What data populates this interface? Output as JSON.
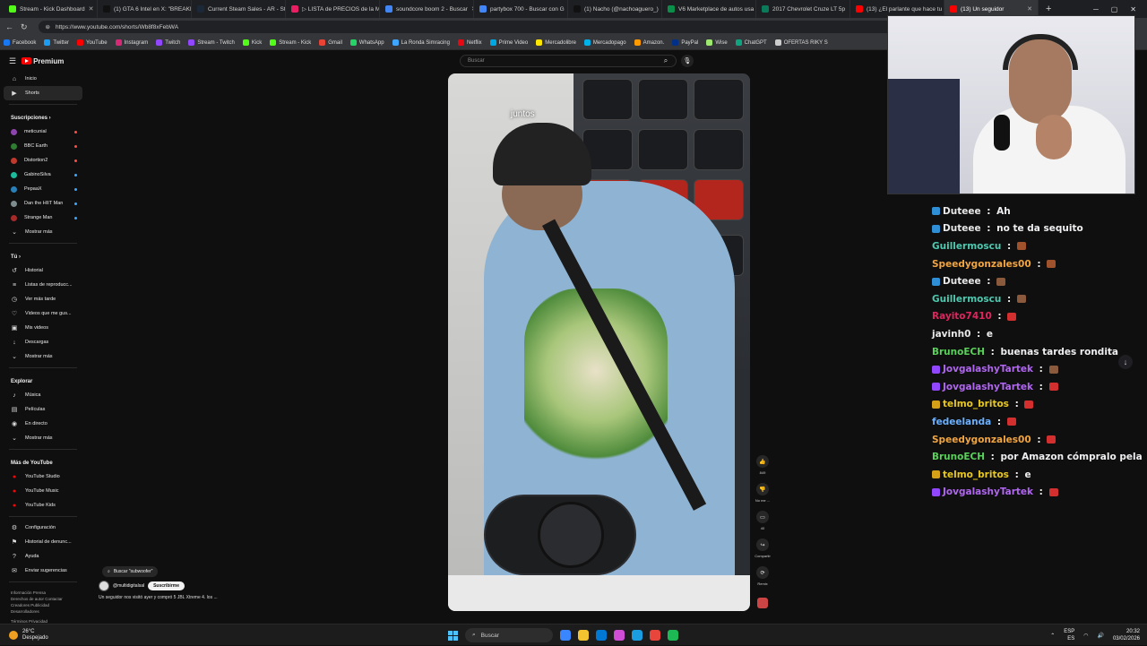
{
  "browser": {
    "tabs": [
      {
        "title": "Stream - Kick Dashboard",
        "color": "#53fc18"
      },
      {
        "title": "(1) GTA 6 Intel en X: \"BREAKI",
        "color": "#111111"
      },
      {
        "title": "Current Steam Sales - AR - St",
        "color": "#1b2838"
      },
      {
        "title": "▷ LISTA de PRECIOS de la M",
        "color": "#e91e63"
      },
      {
        "title": "soundcore boom 2 - Buscar",
        "color": "#4285f4"
      },
      {
        "title": "partybox 700 - Buscar con G",
        "color": "#4285f4"
      },
      {
        "title": "(1) Nacho (@nachoaguero_)",
        "color": "#111111"
      },
      {
        "title": "V6 Marketplace de autos usa",
        "color": "#0a8f4a"
      },
      {
        "title": "2017 Chevrolet Cruze LT 5p",
        "color": "#0b7a5a"
      },
      {
        "title": "(13) ¿El parlante que hace tu",
        "color": "#ff0000"
      },
      {
        "title": "(13) Un seguidor",
        "color": "#ff0000"
      }
    ],
    "new_tab": "+",
    "url": "https://www.youtube.com/shorts/Wb8f8xFebWA",
    "bookmarks": [
      {
        "label": "Facebook",
        "color": "#1877f2"
      },
      {
        "label": "Twitter",
        "color": "#1d9bf0"
      },
      {
        "label": "YouTube",
        "color": "#ff0000"
      },
      {
        "label": "Instagram",
        "color": "#d62976"
      },
      {
        "label": "Twitch",
        "color": "#9146ff"
      },
      {
        "label": "Stream - Twitch",
        "color": "#9146ff"
      },
      {
        "label": "Kick",
        "color": "#53fc18"
      },
      {
        "label": "Stream - Kick",
        "color": "#53fc18"
      },
      {
        "label": "Gmail",
        "color": "#ea4335"
      },
      {
        "label": "WhatsApp",
        "color": "#25d366"
      },
      {
        "label": "La Ronda Simracing",
        "color": "#3ea6ff"
      },
      {
        "label": "Netflix",
        "color": "#e50914"
      },
      {
        "label": "Prime Video",
        "color": "#00a8e1"
      },
      {
        "label": "Mercadolibre",
        "color": "#ffe600"
      },
      {
        "label": "Mercadopago",
        "color": "#00b1ea"
      },
      {
        "label": "Amazon.",
        "color": "#ff9900"
      },
      {
        "label": "PayPal",
        "color": "#003087"
      },
      {
        "label": "Wise",
        "color": "#9fe870"
      },
      {
        "label": "ChatGPT",
        "color": "#10a37f"
      },
      {
        "label": "OFERTAS RIKY S",
        "color": "#cccccc"
      }
    ]
  },
  "youtube": {
    "brand": "Premium",
    "search_placeholder": "Buscar",
    "nav_main": [
      {
        "label": "Inicio",
        "icon": "home-icon",
        "glyph": "⌂"
      },
      {
        "label": "Shorts",
        "icon": "shorts-icon",
        "glyph": "▶"
      }
    ],
    "subscriptions_title": "Suscripciones",
    "subscriptions": [
      {
        "label": "meticunial",
        "color": "#8e44ad",
        "live": true
      },
      {
        "label": "BBC Earth",
        "color": "#2e7d32",
        "live": true
      },
      {
        "label": "Distortion2",
        "color": "#c0392b",
        "live": true
      },
      {
        "label": "GabinoSilva",
        "color": "#1abc9c",
        "live": false
      },
      {
        "label": "PepaaX",
        "color": "#2980b9",
        "live": false
      },
      {
        "label": "Dan the HIIT Man",
        "color": "#7f8c8d",
        "live": false
      },
      {
        "label": "Strange Man",
        "color": "#a52a2a",
        "live": false
      }
    ],
    "show_more": "Mostrar más",
    "you_title": "Tú",
    "you_items": [
      {
        "label": "Historial",
        "glyph": "↺",
        "icon": "history-icon"
      },
      {
        "label": "Listas de reproducc...",
        "glyph": "≡",
        "icon": "playlist-icon"
      },
      {
        "label": "Ver más tarde",
        "glyph": "◷",
        "icon": "clock-icon"
      },
      {
        "label": "Videos que me gus...",
        "glyph": "♡",
        "icon": "like-icon"
      },
      {
        "label": "Mis videos",
        "glyph": "▣",
        "icon": "my-videos-icon"
      },
      {
        "label": "Descargas",
        "glyph": "↓",
        "icon": "download-icon"
      }
    ],
    "explore_title": "Explorar",
    "explore_items": [
      {
        "label": "Música",
        "glyph": "♪",
        "icon": "music-icon"
      },
      {
        "label": "Películas",
        "glyph": "▤",
        "icon": "movie-icon"
      },
      {
        "label": "En directo",
        "glyph": "◉",
        "icon": "live-icon"
      }
    ],
    "more_title": "Más de YouTube",
    "more_items": [
      {
        "label": "YouTube Studio",
        "color": "#ff0000"
      },
      {
        "label": "YouTube Music",
        "color": "#ff0000"
      },
      {
        "label": "YouTube Kids",
        "color": "#ff0000"
      }
    ],
    "settings_items": [
      {
        "label": "Configuración",
        "glyph": "⚙",
        "icon": "gear-icon"
      },
      {
        "label": "Historial de denunc...",
        "glyph": "⚑",
        "icon": "flag-icon"
      },
      {
        "label": "Ayuda",
        "glyph": "?",
        "icon": "help-icon"
      },
      {
        "label": "Enviar sugerencias",
        "glyph": "✉",
        "icon": "feedback-icon"
      }
    ],
    "footer_line1": "Información  Prensa",
    "footer_line2": "Derechos de autor  Contactar",
    "footer_line3": "Creadores  Publicidad",
    "footer_line4": "Desarrolladores",
    "footer_line5": "Términos  Privacidad",
    "short": {
      "caption": "juntos",
      "suggested_search": "Buscar \"subwoofer\"",
      "channel": "@multidigitalsal",
      "subscribe": "Suscribirme",
      "description": "Un seguidor nos visitó ayer y compró 5 JBL Xtreme 4. los ..."
    },
    "actions": [
      {
        "label": "849",
        "glyph": "👍",
        "icon": "like-icon"
      },
      {
        "label": "No me ...",
        "glyph": "👎",
        "icon": "dislike-icon"
      },
      {
        "label": "40",
        "glyph": "▭",
        "icon": "comment-icon"
      },
      {
        "label": "Compartir",
        "glyph": "↪",
        "icon": "share-icon"
      },
      {
        "label": "Remix",
        "glyph": "⟳",
        "icon": "remix-icon"
      }
    ]
  },
  "chat": {
    "messages": [
      {
        "user": "Duteee",
        "color": "#e8e8e8",
        "text": "Ah",
        "badge": "#2e8fd6",
        "emote": ""
      },
      {
        "user": "Duteee",
        "color": "#e8e8e8",
        "text": "no te da sequito",
        "badge": "#2e8fd6",
        "emote": ""
      },
      {
        "user": "Guillermoscu",
        "color": "#4ec9b0",
        "text": "",
        "badge": "",
        "emote": "#a0522d"
      },
      {
        "user": "Speedygonzales00",
        "color": "#f2a540",
        "text": "",
        "badge": "",
        "emote": "#a0522d"
      },
      {
        "user": "Duteee",
        "color": "#e8e8e8",
        "text": "",
        "badge": "#2e8fd6",
        "emote": "#8b5a3c"
      },
      {
        "user": "Guillermoscu",
        "color": "#4ec9b0",
        "text": "",
        "badge": "",
        "emote": "#8b5a3c"
      },
      {
        "user": "Rayito7410",
        "color": "#e0245e",
        "text": "",
        "badge": "",
        "emote": "#d32f2f"
      },
      {
        "user": "javinh0",
        "color": "#e8e8e8",
        "text": "e",
        "badge": "",
        "emote": ""
      },
      {
        "user": "BrunoECH",
        "color": "#5ad15a",
        "text": "buenas tardes rondita",
        "badge": "",
        "emote": ""
      },
      {
        "user": "JovgalashyTartek",
        "color": "#b066f0",
        "text": "",
        "badge": "#9146ff",
        "emote": "#8b5a3c"
      },
      {
        "user": "JovgalashyTartek",
        "color": "#b066f0",
        "text": "",
        "badge": "#9146ff",
        "emote": "#d32f2f"
      },
      {
        "user": "telmo_britos",
        "color": "#e8c820",
        "text": "",
        "badge": "#d4a017",
        "emote": "#d32f2f"
      },
      {
        "user": "fedeelanda",
        "color": "#6ab0ff",
        "text": "",
        "badge": "",
        "emote": "#d32f2f"
      },
      {
        "user": "Speedygonzales00",
        "color": "#f2a540",
        "text": "",
        "badge": "",
        "emote": "#d32f2f"
      },
      {
        "user": "BrunoECH",
        "color": "#5ad15a",
        "text": "por Amazon cómpralo pela",
        "badge": "",
        "emote": ""
      },
      {
        "user": "telmo_britos",
        "color": "#e8c820",
        "text": "e",
        "badge": "#d4a017",
        "emote": ""
      },
      {
        "user": "JovgalashyTartek",
        "color": "#b066f0",
        "text": "",
        "badge": "#9146ff",
        "emote": "#d32f2f"
      }
    ],
    "separator": " : "
  },
  "taskbar": {
    "temp": "26°C",
    "weather": "Despejado",
    "search": "Buscar",
    "lang": "ESP",
    "lang2": "ES",
    "time": "20:32",
    "date": "03/02/2026",
    "apps": [
      "#3a86ff",
      "#f4c430",
      "#0078d4",
      "#d04ed6",
      "#1b9de2",
      "#e8453c",
      "#1db954"
    ]
  }
}
